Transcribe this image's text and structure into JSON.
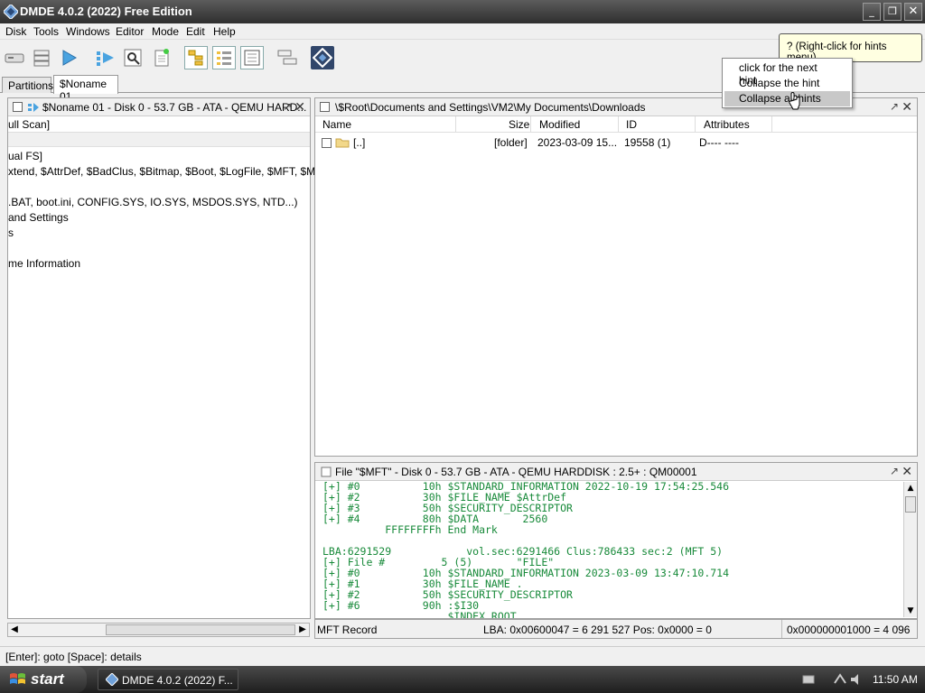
{
  "window": {
    "title": "DMDE 4.0.2 (2022) Free Edition",
    "min_label": "_",
    "max_label": "❐",
    "close_label": "✕"
  },
  "menu": [
    "Disk",
    "Tools",
    "Windows",
    "Editor",
    "Mode",
    "Edit",
    "Help"
  ],
  "tabs": {
    "partitions": "Partitions",
    "noname": "$Noname 01"
  },
  "left_panel": {
    "title": "$Noname 01 - Disk 0 - 53.7 GB - ATA - QEMU HARD...",
    "max_label": "↗",
    "close_label": "✕",
    "header_text": "ull Scan]",
    "lines": [
      "ual FS]",
      "xtend, $AttrDef, $BadClus, $Bitmap, $Boot, $LogFile, $MFT, $MFTMi...",
      "",
      ".BAT, boot.ini, CONFIG.SYS, IO.SYS, MSDOS.SYS, NTD...)",
      "and Settings",
      "s",
      "",
      "me Information"
    ]
  },
  "files_panel": {
    "path": "\\$Root\\Documents and Settings\\VM2\\My Documents\\Downloads",
    "columns": {
      "name": "Name",
      "size": "Size",
      "modified": "Modified",
      "id": "ID",
      "attributes": "Attributes"
    },
    "rows": [
      {
        "name": "[..]",
        "size": "[folder]",
        "modified": "2023-03-09 15...",
        "id": "19558 (1)",
        "attributes": "D---- ----"
      }
    ]
  },
  "mft_panel": {
    "title": "File \"$MFT\" - Disk 0 - 53.7 GB - ATA - QEMU HARDDISK : 2.5+ : QM00001",
    "lines": [
      "[+] #0          10h $STANDARD_INFORMATION 2022-10-19 17:54:25.546",
      "[+] #2          30h $FILE_NAME $AttrDef",
      "[+] #3          50h $SECURITY_DESCRIPTOR",
      "[+] #4          80h $DATA       2560",
      "          FFFFFFFFh End Mark",
      "",
      "LBA:6291529            vol.sec:6291466 Clus:786433 sec:2 (MFT 5)",
      "[+] File #         5 (5)       \"FILE\"",
      "[+] #0          10h $STANDARD_INFORMATION 2023-03-09 13:47:10.714",
      "[+] #1          30h $FILE_NAME .",
      "[+] #2          50h $SECURITY_DESCRIPTOR",
      "[+] #6          90h :$I30",
      "                    $INDEX_ROOT"
    ],
    "status": {
      "record": "MFT Record",
      "lba": "LBA: 0x00600047 = 6 291 527  Pos: 0x0000 = 0",
      "offset": "0x000000001000 = 4 096"
    }
  },
  "tooltip": "? (Right-click for hints menu)",
  "context_menu": [
    "click for the next hint",
    "Collapse the hint",
    "Collapse all hints"
  ],
  "hint_bar": "[Enter]: goto  [Space]: details",
  "taskbar": {
    "start": "start",
    "task": "DMDE 4.0.2 (2022) F...",
    "clock": "11:50 AM"
  },
  "colors": {
    "hex_text": "#188a3a",
    "accent": "#31466a"
  }
}
